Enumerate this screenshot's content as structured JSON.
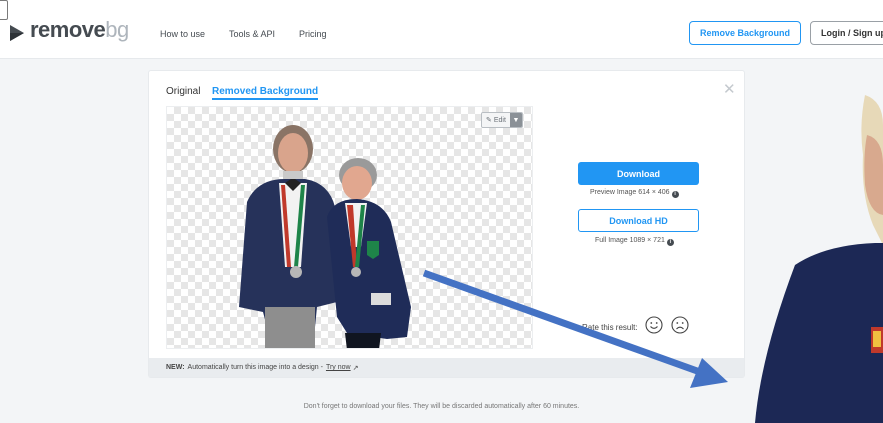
{
  "header": {
    "logo": {
      "main": "remove",
      "accent": "bg"
    },
    "nav": [
      {
        "label": "How to use"
      },
      {
        "label": "Tools & API"
      },
      {
        "label": "Pricing"
      }
    ],
    "remove_background_label": "Remove Background",
    "login_label": "Login / Sign up"
  },
  "card": {
    "tabs": {
      "original": "Original",
      "removed": "Removed Background",
      "active": "removed"
    },
    "close_icon": "close-icon",
    "edit_label": "Edit",
    "download": {
      "label": "Download",
      "preview_text": "Preview Image 614 × 406",
      "hd_label": "Download HD",
      "full_text": "Full Image 1089 × 721"
    },
    "rate": {
      "label": "Rate this result:",
      "happy_icon": "smile-icon",
      "sad_icon": "frown-icon"
    }
  },
  "banner": {
    "bold": "NEW:",
    "text": "Automatically turn this image into a design -",
    "link": "Try now"
  },
  "footer_note": "Don't forget to download your files. They will be discarded automatically after 60 minutes.",
  "colors": {
    "accent": "#2196f3",
    "arrow": "#4472c4",
    "page_bg": "#f3f5f7",
    "logo_dark": "#454b51",
    "logo_light": "#aeb5bc"
  }
}
